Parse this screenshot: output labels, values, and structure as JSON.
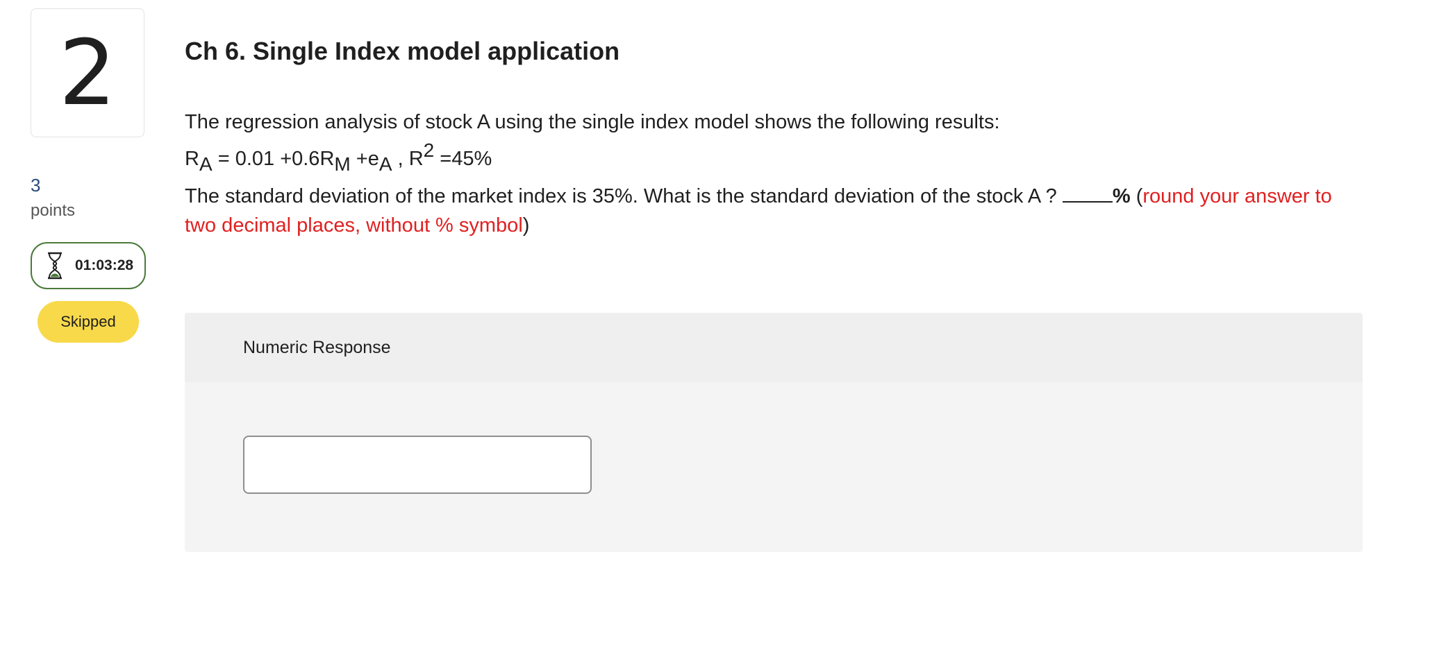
{
  "question": {
    "number": "2",
    "points_value": "3",
    "points_label": "points",
    "timer": "01:03:28",
    "status": "Skipped",
    "title": "Ch 6. Single Index model application",
    "intro": "The regression analysis of stock A using the single index model shows the following results:",
    "equation": {
      "r": "R",
      "sub_a": "A",
      "eq_mid": " = 0.01 +0.6R",
      "sub_m": "M",
      "eq_e": " +e",
      "sub_a2": "A",
      "sep": " ,  R",
      "sup_2": "2",
      "eq_end": " =45%"
    },
    "prompt": "The standard deviation of the market index is 35%.  What is the standard deviation of the stock A ? ",
    "blank_suffix": "%",
    "paren_open": " (",
    "instruction": "round your answer to two decimal places, without % symbol",
    "paren_close": ")"
  },
  "response": {
    "header": "Numeric Response",
    "value": "",
    "placeholder": ""
  },
  "colors": {
    "timer_border": "#4a7a3a",
    "badge": "#f8d94a",
    "instruction_red": "#e02020",
    "points_blue": "#2b4a7a"
  },
  "icons": {
    "timer": "hourglass-icon"
  }
}
